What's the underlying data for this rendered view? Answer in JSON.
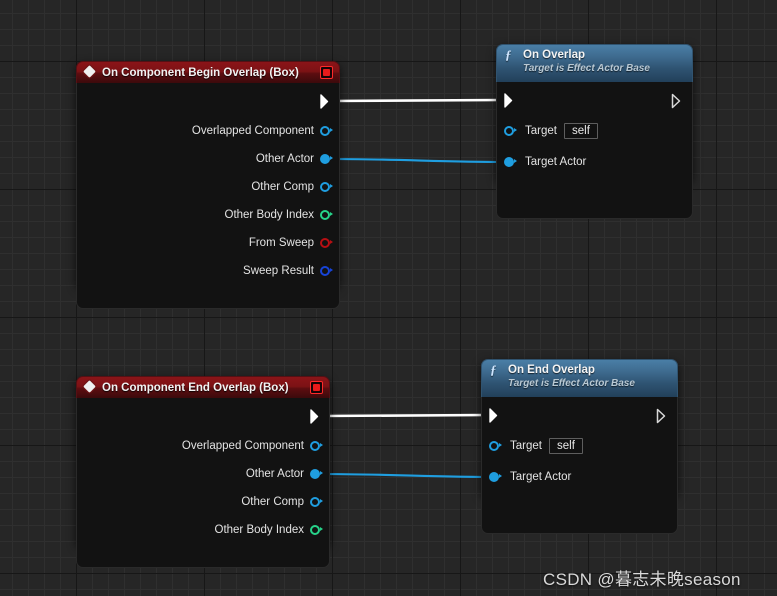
{
  "canvas": {
    "background_color": "#262626",
    "grid_minor_color": "#2f2f2f",
    "grid_major_color": "#171717"
  },
  "watermark": {
    "text": "CSDN @暮志未晚season"
  },
  "nodes": [
    {
      "id": "on-component-begin-overlap",
      "kind": "event",
      "title": "On Component Begin Overlap (Box)",
      "icon": "event-diamond-icon",
      "delegate_icon": "delegate-square-icon",
      "accent": "#8b1418",
      "exec_out": "",
      "pins": [
        {
          "label": "Overlapped Component",
          "color": "#1f9ee0",
          "style": "ring"
        },
        {
          "label": "Other Actor",
          "color": "#1f9ee0",
          "style": "filled"
        },
        {
          "label": "Other Comp",
          "color": "#1f9ee0",
          "style": "ring"
        },
        {
          "label": "Other Body Index",
          "color": "#27d38a",
          "style": "ring"
        },
        {
          "label": "From Sweep",
          "color": "#b80f13",
          "style": "ring"
        },
        {
          "label": "Sweep Result",
          "color": "#1744d8",
          "style": "ring"
        }
      ]
    },
    {
      "id": "on-overlap",
      "kind": "function",
      "title": "On Overlap",
      "subtitle": "Target is Effect Actor Base",
      "icon": "function-f-icon",
      "accent": "#3f6c90",
      "pins": [
        {
          "label": "Target",
          "color": "#1f9ee0",
          "style": "ring",
          "value": "self"
        },
        {
          "label": "Target Actor",
          "color": "#1f9ee0",
          "style": "filled",
          "value": ""
        }
      ]
    },
    {
      "id": "on-component-end-overlap",
      "kind": "event",
      "title": "On Component End Overlap (Box)",
      "icon": "event-diamond-icon",
      "delegate_icon": "delegate-square-icon",
      "accent": "#8b1418",
      "pins": [
        {
          "label": "Overlapped Component",
          "color": "#1f9ee0",
          "style": "ring"
        },
        {
          "label": "Other Actor",
          "color": "#1f9ee0",
          "style": "filled"
        },
        {
          "label": "Other Comp",
          "color": "#1f9ee0",
          "style": "ring"
        },
        {
          "label": "Other Body Index",
          "color": "#27d38a",
          "style": "ring"
        }
      ]
    },
    {
      "id": "on-end-overlap",
      "kind": "function",
      "title": "On End Overlap",
      "subtitle": "Target is Effect Actor Base",
      "icon": "function-f-icon",
      "accent": "#3f6c90",
      "pins": [
        {
          "label": "Target",
          "color": "#1f9ee0",
          "style": "ring",
          "value": "self"
        },
        {
          "label": "Target Actor",
          "color": "#1f9ee0",
          "style": "filled",
          "value": ""
        }
      ]
    }
  ],
  "wires": [
    {
      "type": "exec",
      "color": "#ffffff",
      "from": "on-component-begin-overlap",
      "to": "on-overlap"
    },
    {
      "type": "data",
      "color": "#1f9ee0",
      "from": "other-actor",
      "to": "target-actor"
    },
    {
      "type": "exec",
      "color": "#ffffff",
      "from": "on-component-end-overlap",
      "to": "on-end-overlap"
    },
    {
      "type": "data",
      "color": "#1f9ee0",
      "from": "other-actor",
      "to": "target-actor"
    }
  ]
}
